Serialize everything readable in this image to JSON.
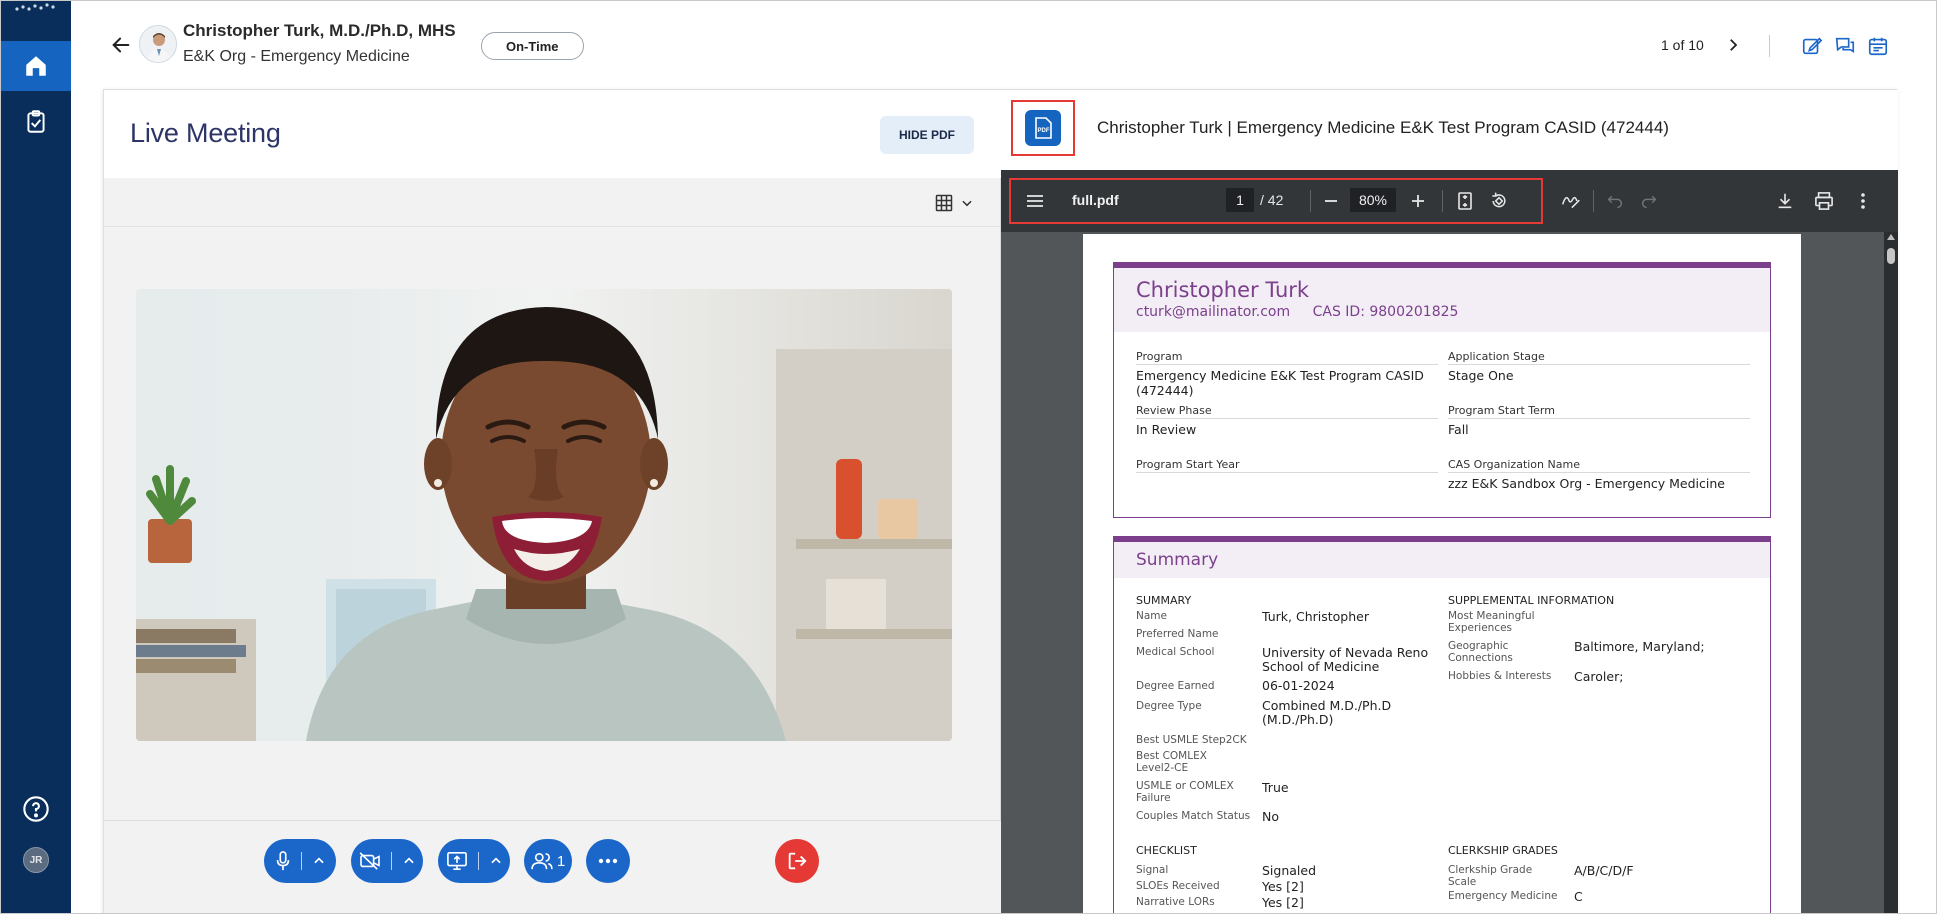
{
  "header": {
    "name": "Christopher Turk, M.D./Ph.D, MHS",
    "org": "E&K Org - Emergency Medicine",
    "status": "On-Time",
    "pager": "1 of 10"
  },
  "rail": {
    "avatar_initials": "JR"
  },
  "meeting": {
    "title": "Live Meeting",
    "hide_pdf_label": "HIDE PDF",
    "participants_count": "1"
  },
  "pdf": {
    "heading": "Christopher Turk | Emergency Medicine E&K Test Program CASID (472444)",
    "icon_label": "PDF",
    "filename": "full.pdf",
    "current_page": "1",
    "total_pages": "/ 42",
    "zoom": "80%"
  },
  "document": {
    "candidate_name": "Christopher Turk",
    "email": "cturk@mailinator.com",
    "cas_id": "CAS ID: 9800201825",
    "fields": [
      {
        "label": "Program",
        "value": "Emergency Medicine E&K Test Program CASID (472444)"
      },
      {
        "label": "Application Stage",
        "value": "Stage One"
      },
      {
        "label": "Review Phase",
        "value": "In Review"
      },
      {
        "label": "Program Start Term",
        "value": "Fall"
      },
      {
        "label": "Program Start Year",
        "value": ""
      },
      {
        "label": "CAS Organization Name",
        "value": "zzz E&K Sandbox Org - Emergency Medicine"
      }
    ],
    "summary": {
      "title": "Summary",
      "summary_head": "SUMMARY",
      "summary_rows": [
        {
          "label": "Name",
          "value": "Turk, Christopher"
        },
        {
          "label": "Preferred Name",
          "value": ""
        },
        {
          "label": "Medical School",
          "value": "University of Nevada Reno School of Medicine"
        },
        {
          "label": "Degree Earned",
          "value": "06-01-2024"
        },
        {
          "label": "Degree Type",
          "value": "Combined M.D./Ph.D (M.D./Ph.D)"
        },
        {
          "label": "Best USMLE Step2CK",
          "value": ""
        },
        {
          "label": "Best COMLEX Level2-CE",
          "value": ""
        },
        {
          "label": "USMLE or COMLEX Failure",
          "value": "True"
        },
        {
          "label": "Couples Match Status",
          "value": "No"
        }
      ],
      "supplemental_head": "SUPPLEMENTAL INFORMATION",
      "supplemental_rows": [
        {
          "label": "Most Meaningful Experiences",
          "value": ""
        },
        {
          "label": "Geographic Connections",
          "value": "Baltimore, Maryland;"
        },
        {
          "label": "Hobbies & Interests",
          "value": "Caroler;"
        }
      ],
      "checklist_head": "CHECKLIST",
      "checklist_rows": [
        {
          "label": "Signal",
          "value": "Signaled"
        },
        {
          "label": "SLOEs Received",
          "value": "Yes [2]"
        },
        {
          "label": "Narrative LORs",
          "value": "Yes [2]"
        }
      ],
      "clerkship_head": "CLERKSHIP GRADES",
      "clerkship_rows": [
        {
          "label": "Clerkship Grade Scale",
          "value": "A/B/C/D/F"
        },
        {
          "label": "Emergency Medicine",
          "value": "C"
        }
      ]
    }
  },
  "colors": {
    "rail": "#0a2e5c",
    "accent": "#1b66c9",
    "leave": "#e53935",
    "doc_accent": "#7b3f8c",
    "highlight_box": "#e53935"
  }
}
